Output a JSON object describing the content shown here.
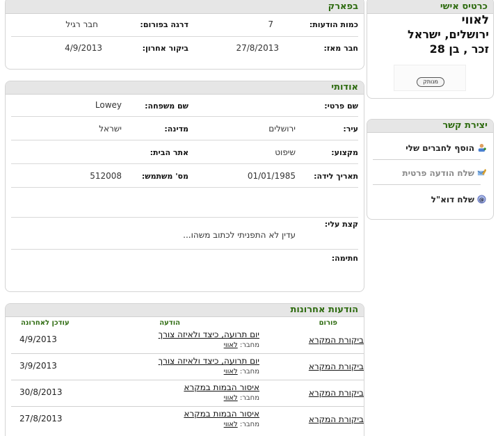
{
  "profile_card": {
    "title": "כרטיס אישי",
    "name": "לאווי",
    "location": "ירושלים, ישראל",
    "gender_age": "זכר , בן 28",
    "status_badge": "מנותק"
  },
  "contact": {
    "title": "יצירת קשר",
    "items": [
      {
        "label": "הוסף לחברים שלי",
        "icon": "add-friend-icon"
      },
      {
        "label": "שלח הודעה פרטית",
        "icon": "private-message-icon"
      },
      {
        "label": "שלח דוא\"ל",
        "icon": "email-icon"
      }
    ]
  },
  "forum_stats": {
    "title": "בפארק",
    "posts_label": "כמות הודעות:",
    "posts_value": "7",
    "rank_label": "דרגה בפורום:",
    "rank_value": "חבר רגיל",
    "member_since_label": "חבר מאז:",
    "member_since_value": "27/8/2013",
    "last_visit_label": "ביקור אחרון:",
    "last_visit_value": "4/9/2013"
  },
  "about": {
    "title": "אודותי",
    "first_name_label": "שם פרטי:",
    "first_name_value": "",
    "last_name_label": "שם משפחה:",
    "last_name_value": "Lowey",
    "city_label": "עיר:",
    "city_value": "ירושלים",
    "country_label": "מדינה:",
    "country_value": "ישראל",
    "profession_label": "מקצוע:",
    "profession_value": "שיפוט",
    "website_label": "אתר הבית:",
    "website_value": "",
    "birthdate_label": "תאריך לידה:",
    "birthdate_value": "01/01/1985",
    "user_id_label": "מס' משתמש:",
    "user_id_value": "512008",
    "bio_label": "קצת עלי:",
    "bio_value": "עדין לא התפניתי לכתוב משהו...",
    "signature_label": "חתימה:",
    "signature_value": ""
  },
  "recent_posts": {
    "title": "הודעות אחרונות",
    "headers": {
      "forum": "פורום",
      "message": "הודעה",
      "updated": "עודכן לאחרונה"
    },
    "author_prefix": "מחבר:",
    "rows": [
      {
        "forum": "ביקורת המקרא",
        "title": "יום תרועה, כיצד ולאיזה צורך",
        "author": "לאווי",
        "date": "4/9/2013"
      },
      {
        "forum": "ביקורת המקרא",
        "title": "יום תרועה, כיצד ולאיזה צורך",
        "author": "לאווי",
        "date": "3/9/2013"
      },
      {
        "forum": "ביקורת המקרא",
        "title": "איסור הבמות במקרא",
        "author": "לאווי",
        "date": "30/8/2013"
      },
      {
        "forum": "ביקורת המקרא",
        "title": "איסור הבמות במקרא",
        "author": "לאווי",
        "date": "27/8/2013"
      }
    ]
  }
}
